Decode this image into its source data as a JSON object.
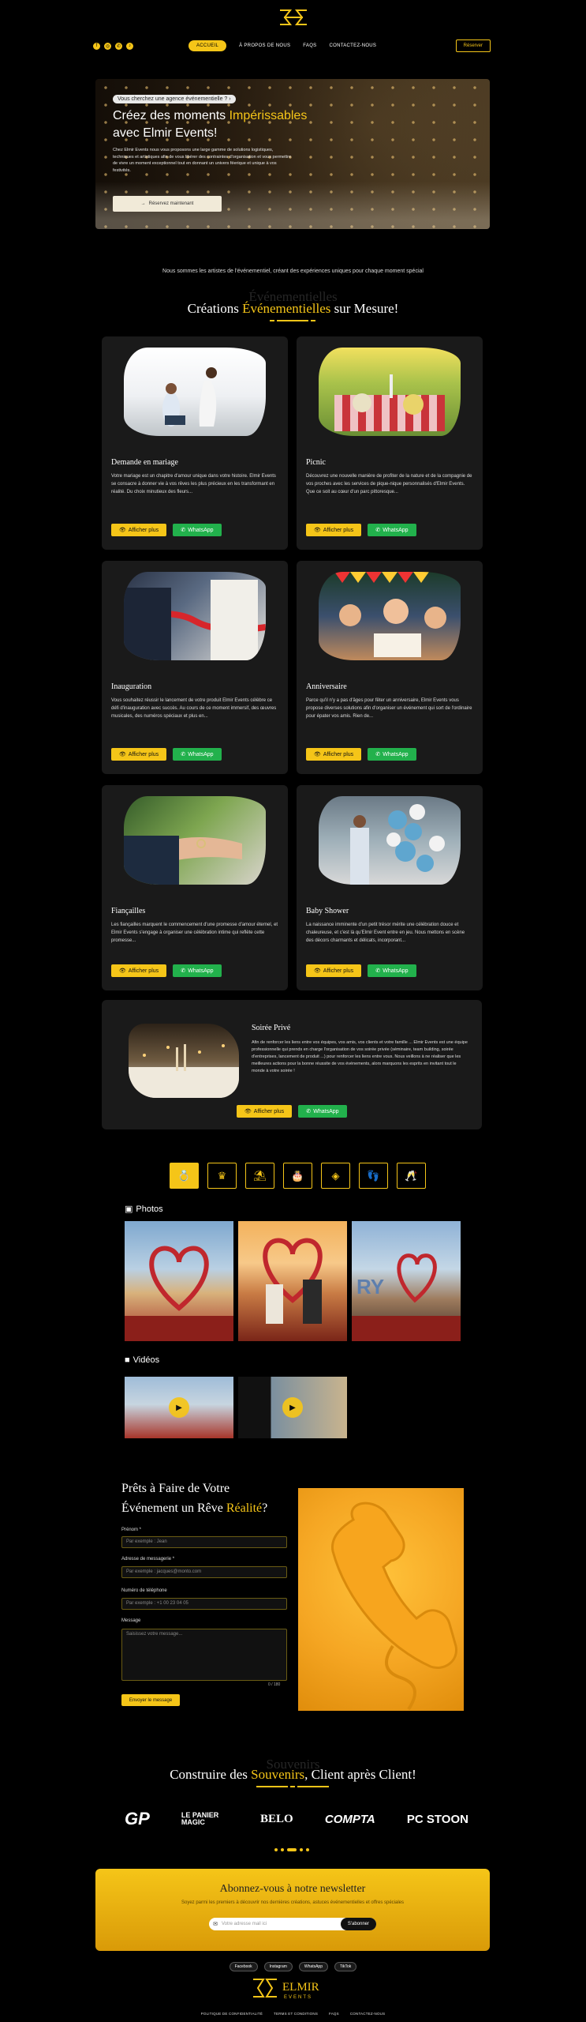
{
  "brand": {
    "logo_alt": "Elmir Events logo",
    "footer_logo_text": "ELMIR",
    "footer_logo_sub": "EVENTS",
    "gold": "#f5c518"
  },
  "header": {
    "social_icons": [
      "facebook-icon",
      "instagram-icon",
      "whatsapp-icon",
      "tiktok-icon"
    ],
    "nav": [
      "ACCUEIL",
      "À PROPOS DE NOUS",
      "FAQS",
      "CONTACTEZ-NOUS"
    ],
    "active_nav": "ACCUEIL",
    "cta": "Réserver"
  },
  "hero": {
    "tag": "Vous cherchez une agence événementielle ?",
    "title_1": "Créez des moments ",
    "title_highlight": "Impérissables",
    "title_2": "avec Elmir Events!",
    "description": "Chez Elmir Events nous vous proposons une large gamme de solutions logistiques, techniques et artistiques afin de vous libérer des contraintes d'organisation et vous permettre de vivre un moment exceptionnel tout en donnant un univers féerique et unique à vos festivités.",
    "button": "Réservez maintenant"
  },
  "intro": "Nous sommes les artistes de l'événementiel, créant des expériences uniques pour chaque moment spécial",
  "creations": {
    "ghost": "Événementielles",
    "title_1": "Créations ",
    "title_highlight": "Événementielles",
    "title_2": " sur Mesure!"
  },
  "cards": [
    {
      "title": "Demande en mariage",
      "desc": "Votre mariage est un chapitre d'amour unique dans votre histoire. Elmir Events se consacre à donner vie à vos rêves les plus précieux en les transformant en réalité. Du choix minutieux des fleurs...",
      "more": "Afficher plus",
      "whatsapp": "WhatsApp"
    },
    {
      "title": "Picnic",
      "desc": "Découvrez une nouvelle manière de profiter de la nature et de la compagnie de vos proches avec les services de pique-nique personnalisés d'Elmir Events. Que ce soit au cœur d'un parc pittoresque...",
      "more": "Afficher plus",
      "whatsapp": "WhatsApp"
    },
    {
      "title": "Inauguration",
      "desc": "Vous souhaitez réussir le lancement de votre produit Elmir Events célèbre ce défi d'inauguration avec succès. Au cours de ce moment immersif, des œuvres musicales, des numéros spéciaux et plus en...",
      "more": "Afficher plus",
      "whatsapp": "WhatsApp"
    },
    {
      "title": "Anniversaire",
      "desc": "Parce qu'il n'y a pas d'âges pour fêter un anniversaire, Elmir Events vous propose diverses solutions afin d'organiser un événement qui sort de l'ordinaire pour épater vos amis. Rien de...",
      "more": "Afficher plus",
      "whatsapp": "WhatsApp"
    },
    {
      "title": "Fiançailles",
      "desc": "Les fiançailles marquent le commencement d'une promesse d'amour éternel, et Elmir Events s'engage à organiser une célébration intime qui reflète cette promesse...",
      "more": "Afficher plus",
      "whatsapp": "WhatsApp"
    },
    {
      "title": "Baby Shower",
      "desc": "La naissance imminente d'un petit trésor mérite une célébration douce et chaleureuse, et c'est là qu'Elmir Event entre en jeu. Nous mettons en scène des décors charmants et délicats, incorporant...",
      "more": "Afficher plus",
      "whatsapp": "WhatsApp"
    }
  ],
  "soiree": {
    "title": "Soirée Privé",
    "desc": "Afin de renforcer les liens entre vos équipes, vos amis, vos clients et votre famille ... Elmir Events est une équipe professionnelle qui prends en charge l'organisation de vos soirée privée (séminaire, team building, soirée d'entreprises, lancement de produit ...) pour renforcer les liens entre vous. Nous veillons à ne réaliser que les meilleures actions pour la bonne réussite de vos événements, alors marquons les esprits en invitant tout le monde à votre soirée !",
    "more": "Afficher plus",
    "whatsapp": "WhatsApp"
  },
  "categories": [
    "rings-icon",
    "crown-cake-icon",
    "picnic-icon",
    "birthday-cake-icon",
    "proposal-ring-icon",
    "baby-feet-icon",
    "party-glasses-icon"
  ],
  "media": {
    "photos_label": "Photos",
    "videos_label": "Vidéos"
  },
  "contact": {
    "title_1": "Prêts à Faire de Votre",
    "title_2": "Événement un Rêve ",
    "title_highlight": "Réalité",
    "title_end": "?",
    "first_name_label": "Prénom *",
    "first_name_ph": "Par exemple : Jean",
    "email_label": "Adresse de messagerie *",
    "email_ph": "Par exemple : jacques@monto.com",
    "phone_label": "Numéro de téléphone",
    "phone_ph": "Par exemple : +1 00 23 04 05",
    "message_label": "Message",
    "message_ph": "Saisissez votre message...",
    "counter": "0 / 180",
    "send": "Envoyer le message"
  },
  "souvenirs": {
    "ghost": "Souvenirs",
    "title_1": "Construire des ",
    "title_highlight": "Souvenirs",
    "title_2": ", Client après Client!"
  },
  "clients": [
    "GP",
    "LE PANIER MAGIC",
    "BELO",
    "COMPTA",
    "PC STOON"
  ],
  "newsletter": {
    "title": "Abonnez-vous à notre newsletter",
    "sub": "Soyez parmi les premiers à découvrir nos dernières créations, astuces événementielles et offres spéciales",
    "placeholder": "Votre adresse mail ici",
    "button": "S'abonner"
  },
  "footer": {
    "social": [
      "Facebook",
      "Instagram",
      "WhatsApp",
      "TikTok"
    ],
    "links": [
      "POLITIQUE DE CONFIDENTIALITÉ",
      "TERMS ET CONDITIONS",
      "FAQS",
      "CONTACTEZ-NOUS"
    ]
  }
}
